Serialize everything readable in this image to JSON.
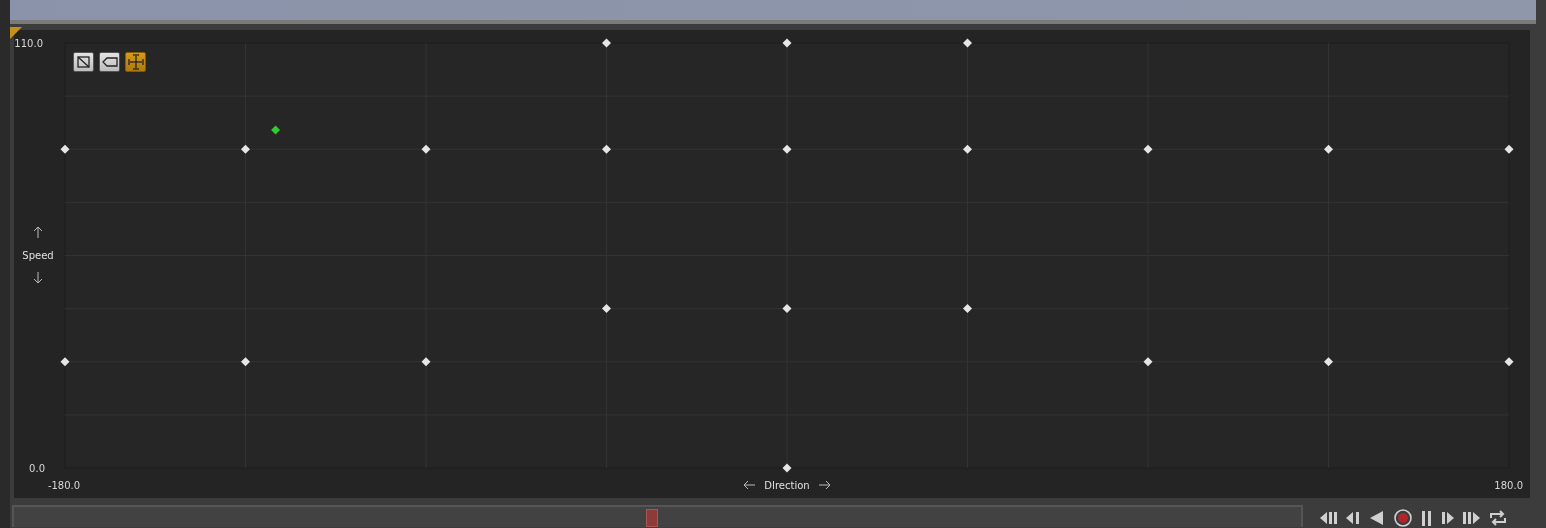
{
  "graph_tools": [
    {
      "kind": "grid",
      "selected": false
    },
    {
      "kind": "label",
      "selected": false
    },
    {
      "kind": "fit",
      "selected": true
    }
  ],
  "chart_data": {
    "type": "scatter",
    "xlabel": "DIrection",
    "ylabel": "Speed",
    "xlim": [
      -180,
      180
    ],
    "ylim": [
      0,
      110
    ],
    "xticks": [
      {
        "value": -180,
        "label": "-180.0"
      },
      {
        "value": 180,
        "label": "180.0"
      }
    ],
    "yticks": [
      {
        "value": 0,
        "label": "0.0"
      },
      {
        "value": 110,
        "label": "110.0"
      }
    ],
    "series": [
      {
        "color": "#e6e6e6",
        "x": [
          -45,
          0,
          45,
          -180,
          -135,
          -90,
          -45,
          0,
          45,
          90,
          135,
          180,
          -45,
          0,
          45,
          -180,
          -135,
          -90,
          90,
          135,
          180,
          0
        ],
        "values": [
          110,
          110,
          110,
          82.5,
          82.5,
          82.5,
          82.5,
          82.5,
          82.5,
          82.5,
          82.5,
          82.5,
          41.3,
          41.3,
          41.3,
          27.5,
          27.5,
          27.5,
          27.5,
          27.5,
          27.5,
          0
        ]
      },
      {
        "color": "#2ecc2e",
        "x": [
          -127.5
        ],
        "values": [
          87.5
        ]
      }
    ]
  },
  "timeline": {
    "level": 0.496
  },
  "transport": [
    {
      "kind": "skip-start"
    },
    {
      "kind": "step-back"
    },
    {
      "kind": "play-reverse"
    },
    {
      "kind": "record"
    },
    {
      "kind": "pause"
    },
    {
      "kind": "step-forward"
    },
    {
      "kind": "skip-end"
    },
    {
      "kind": "loop"
    }
  ]
}
